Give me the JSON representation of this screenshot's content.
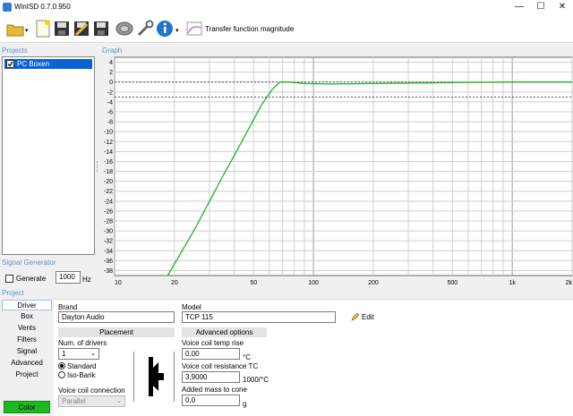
{
  "window": {
    "title": "WinISD 0.7.0.950"
  },
  "toolbar": {
    "graph_select": "Transfer function magnitude"
  },
  "projects": {
    "header": "Projects",
    "items": [
      {
        "label": "PC Boxen",
        "checked": true
      }
    ]
  },
  "graph": {
    "header": "Graph",
    "y_ticks": [
      "4",
      "2",
      "0",
      "-2",
      "-4",
      "-6",
      "-8",
      "-10",
      "-12",
      "-14",
      "-16",
      "-18",
      "-20",
      "-22",
      "-24",
      "-26",
      "-28",
      "-30",
      "-32",
      "-34",
      "-36",
      "-38"
    ],
    "x_ticks": [
      "10",
      "20",
      "50",
      "100",
      "200",
      "500",
      "1k",
      "2k"
    ]
  },
  "chart_data": {
    "type": "line",
    "xscale": "log",
    "xlim": [
      10,
      2000
    ],
    "ylim": [
      -39,
      5
    ],
    "x_ticks": [
      "10",
      "20",
      "50",
      "100",
      "200",
      "500",
      "1k",
      "2k"
    ],
    "y_ticks": [
      4,
      2,
      0,
      -2,
      -4,
      -6,
      -8,
      -10,
      -12,
      -14,
      -16,
      -18,
      -20,
      -22,
      -24,
      -26,
      -28,
      -30,
      -32,
      -34,
      -36,
      -38
    ],
    "reference_lines": [
      0,
      -3
    ],
    "series": [
      {
        "color": "#22b322",
        "x": [
          18.5,
          25,
          35,
          45,
          55,
          62,
          68,
          75,
          90,
          120,
          200,
          500,
          1000,
          2000
        ],
        "y": [
          -39,
          -30,
          -19,
          -11,
          -4.5,
          -1.5,
          0,
          0,
          -0.3,
          -0.4,
          -0.3,
          -0.1,
          0,
          0
        ]
      }
    ]
  },
  "signal_generator": {
    "header": "Signal Generator",
    "generate_label": "Generate",
    "frequency": "1000",
    "unit": "Hz"
  },
  "project": {
    "header": "Project",
    "tabs": [
      "Driver",
      "Box",
      "Vents",
      "Filters",
      "Signal",
      "Advanced",
      "Project"
    ],
    "color_button": "Color",
    "driver": {
      "brand_label": "Brand",
      "brand_value": "Dayton Audio",
      "model_label": "Model",
      "model_value": "TCP 115",
      "edit_label": "Edit",
      "placement_header": "Placement",
      "num_drivers_label": "Num. of drivers",
      "num_drivers_value": "1",
      "radio_standard": "Standard",
      "radio_isobarik": "Iso-Barik",
      "vc_connection_label": "Voice coil connection",
      "vc_connection_value": "Parallel",
      "advanced_header": "Advanced options",
      "vc_temp_label": "Voice coil temp rise",
      "vc_temp_value": "0,00",
      "vc_temp_unit": "°C",
      "vc_res_label": "Voice coil resistance TC",
      "vc_res_value": "3,9000",
      "vc_res_unit": "1000/°C",
      "mass_label": "Added mass to cone",
      "mass_value": "0,0",
      "mass_unit": "g"
    }
  }
}
